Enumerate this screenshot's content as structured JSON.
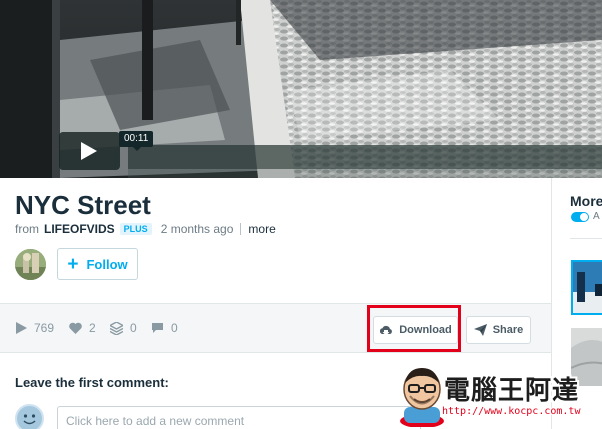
{
  "video": {
    "time_tooltip": "00:11",
    "play_icon": "play-icon"
  },
  "clip": {
    "title": "NYC Street",
    "from_label": "from",
    "author": "LIFEOFVIDS",
    "badge": "PLUS",
    "age": "2 months ago",
    "more_label": "more"
  },
  "follow": {
    "label": "Follow",
    "icon": "plus-icon"
  },
  "stats": {
    "plays": "769",
    "likes": "2",
    "collections": "0",
    "comments": "0"
  },
  "actions": {
    "download_label": "Download",
    "share_label": "Share"
  },
  "comments": {
    "heading": "Leave the first comment:",
    "placeholder": "Click here to add a new comment"
  },
  "sidebar": {
    "title": "More",
    "toggle_label": "A"
  },
  "watermark": {
    "title": "電腦王阿達",
    "url": "http://www.kocpc.com.tw"
  },
  "colors": {
    "accent": "#00adef",
    "highlight": "#e3001b",
    "text": "#1a2e3b"
  }
}
